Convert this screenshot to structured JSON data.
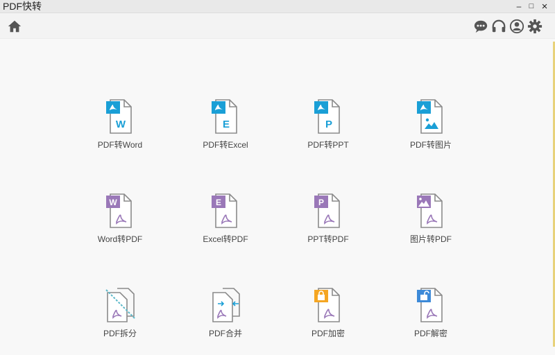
{
  "window": {
    "title": "PDF快转",
    "minimize": "–",
    "maximize": "□",
    "close": "×"
  },
  "toolbar": {
    "home_icon": "home-icon",
    "chat_icon": "chat-icon",
    "headset_icon": "headset-icon",
    "user_icon": "user-icon",
    "settings_icon": "gear-icon"
  },
  "colors": {
    "pdf_badge": "#1a9fd6",
    "office_badge": "#9a78b8",
    "lock_orange": "#f5a623",
    "lock_blue": "#3d8ad8",
    "icon_gray": "#555555"
  },
  "tools": [
    {
      "label": "PDF转Word",
      "badge": "W"
    },
    {
      "label": "PDF转Excel",
      "badge": "E"
    },
    {
      "label": "PDF转PPT",
      "badge": "P"
    },
    {
      "label": "PDF转图片",
      "badge": "image"
    },
    {
      "label": "Word转PDF",
      "badge": "W"
    },
    {
      "label": "Excel转PDF",
      "badge": "E"
    },
    {
      "label": "PPT转PDF",
      "badge": "P"
    },
    {
      "label": "图片转PDF",
      "badge": "image"
    },
    {
      "label": "PDF拆分",
      "badge": "split"
    },
    {
      "label": "PDF合并",
      "badge": "merge"
    },
    {
      "label": "PDF加密",
      "badge": "lock"
    },
    {
      "label": "PDF解密",
      "badge": "unlock"
    }
  ]
}
